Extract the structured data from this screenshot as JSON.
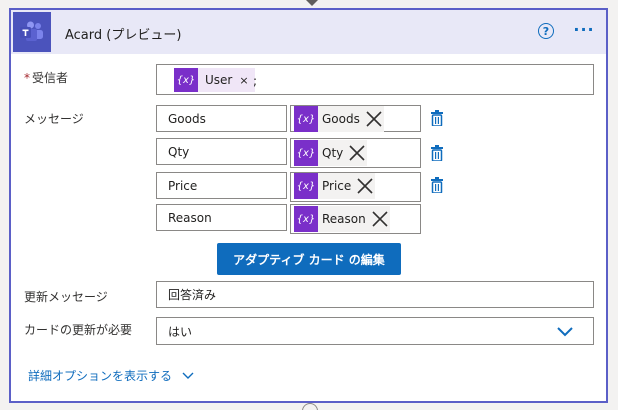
{
  "action": {
    "title": "Acard (プレビュー)",
    "help_glyph": "?",
    "more_glyph": "···"
  },
  "recipient": {
    "required_mark": "*",
    "label": "受信者",
    "token_icon": "{x}",
    "token_label": "User",
    "token_remove": "×",
    "separator": ";"
  },
  "message": {
    "label": "メッセージ",
    "rows": [
      {
        "key": "Goods",
        "token_icon": "{x}",
        "token_label": "Goods"
      },
      {
        "key": "Qty",
        "token_icon": "{x}",
        "token_label": "Qty"
      },
      {
        "key": "Price",
        "token_icon": "{x}",
        "token_label": "Price"
      },
      {
        "key": "Reason",
        "token_icon": "{x}",
        "token_label": "Reason"
      }
    ]
  },
  "edit_button": {
    "label": "アダプティブ カード の編集"
  },
  "update_message": {
    "label": "更新メッセージ",
    "value": "回答済み"
  },
  "update_required": {
    "label": "カードの更新が必要",
    "value": "はい"
  },
  "advanced": {
    "label": "詳細オプションを表示する"
  },
  "colors": {
    "accent": "#0f6cbd",
    "card_border": "#5b5fc7",
    "teams_purple": "#4b53bc",
    "token_purple": "#7a2fc9"
  },
  "icons": {
    "app": "teams-icon",
    "help": "help-icon",
    "more": "more-icon",
    "token": "variable-icon",
    "delete": "trash-icon",
    "dropdown": "chevron-down-icon"
  }
}
